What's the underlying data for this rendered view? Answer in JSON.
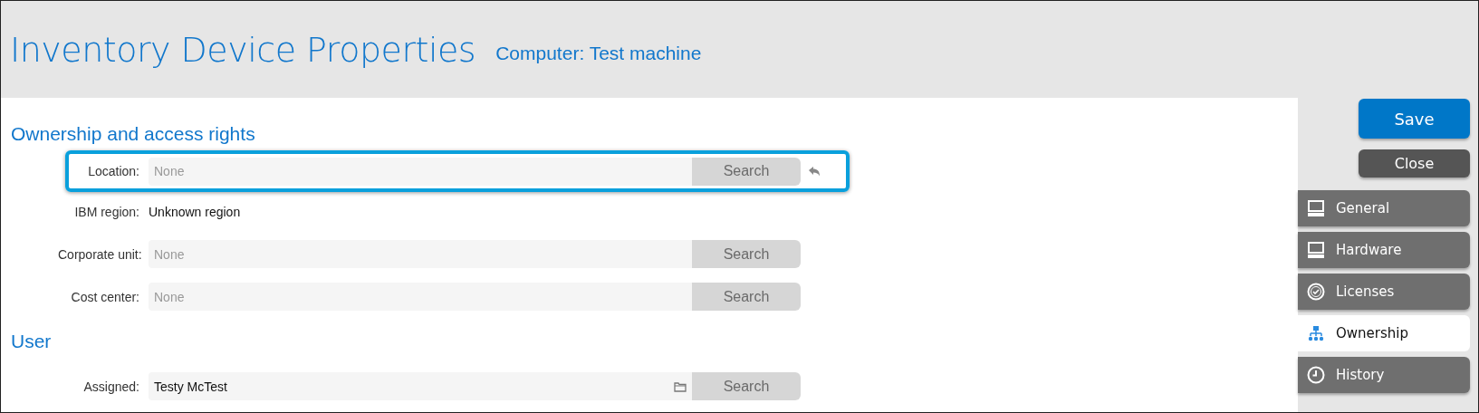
{
  "header": {
    "title": "Inventory Device Properties",
    "subtitle": "Computer: Test machine"
  },
  "sections": [
    {
      "title": "Ownership and access rights",
      "fields": [
        {
          "kind": "lookup",
          "label": "Location:",
          "placeholder": "None",
          "button": "Search",
          "disabled": true,
          "highlighted": true,
          "revertible": true,
          "browsable": false
        },
        {
          "kind": "text",
          "label": "IBM region:",
          "value": "Unknown region"
        },
        {
          "kind": "lookup",
          "label": "Corporate unit:",
          "placeholder": "None",
          "button": "Search",
          "disabled": true,
          "highlighted": false,
          "revertible": false,
          "browsable": false
        },
        {
          "kind": "lookup",
          "label": "Cost center:",
          "placeholder": "None",
          "button": "Search",
          "disabled": true,
          "highlighted": false,
          "revertible": false,
          "browsable": false
        }
      ]
    },
    {
      "title": "User",
      "fields": [
        {
          "kind": "lookup",
          "label": "Assigned:",
          "value": "Testy McTest",
          "button": "Search",
          "disabled": true,
          "highlighted": false,
          "revertible": false,
          "browsable": true
        }
      ]
    }
  ],
  "actions": {
    "save": "Save",
    "close": "Close"
  },
  "tabs": [
    {
      "label": "General",
      "selected": false
    },
    {
      "label": "Hardware",
      "selected": false
    },
    {
      "label": "Licenses",
      "selected": false
    },
    {
      "label": "Ownership",
      "selected": true
    },
    {
      "label": "History",
      "selected": false
    }
  ]
}
